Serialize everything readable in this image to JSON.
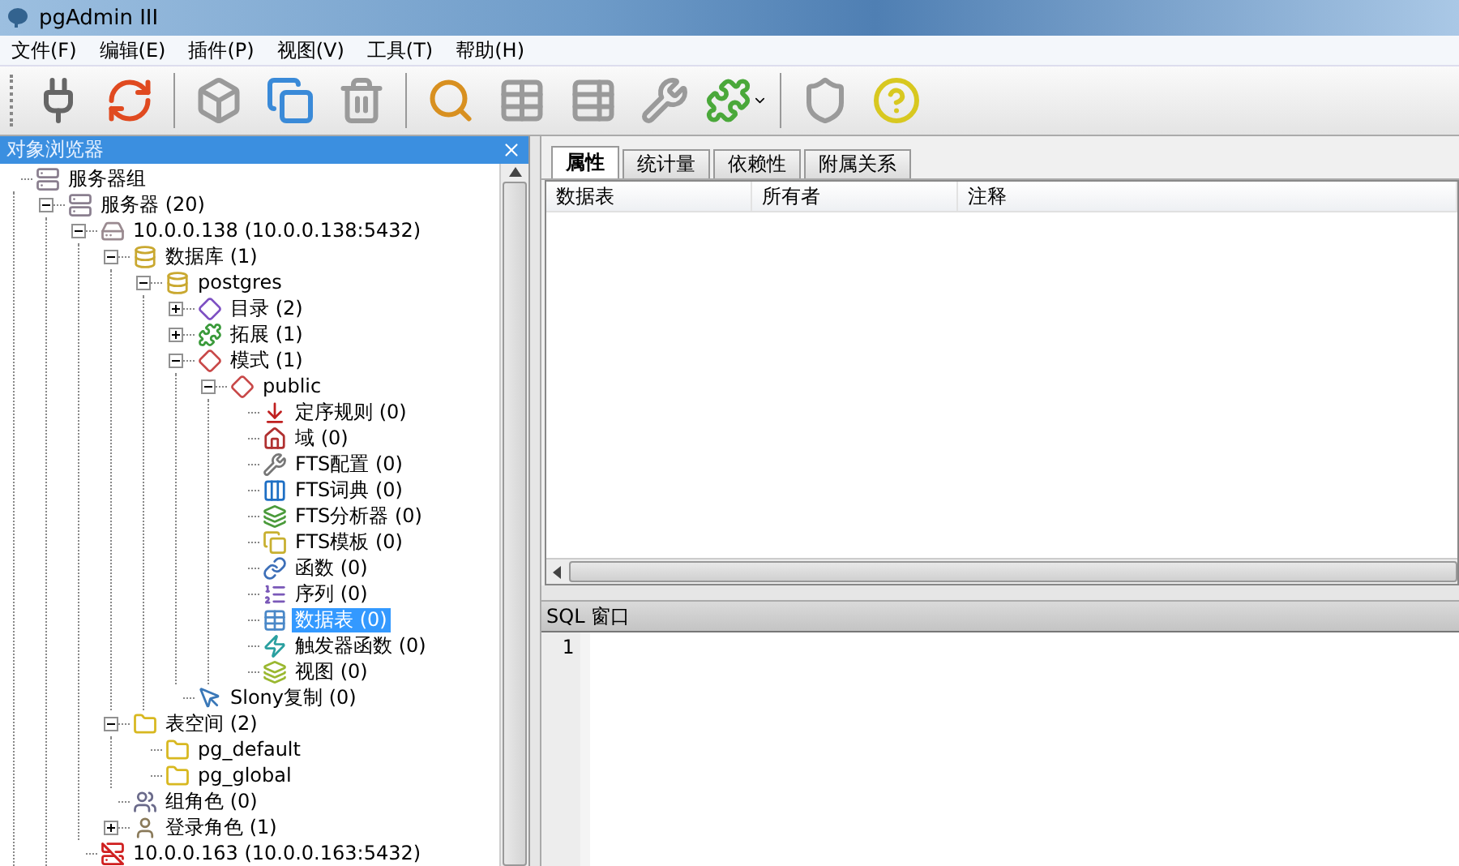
{
  "window": {
    "title": "pgAdmin III"
  },
  "menu": [
    "文件(F)",
    "编辑(E)",
    "插件(P)",
    "视图(V)",
    "工具(T)",
    "帮助(H)"
  ],
  "toolbar": [
    {
      "kind": "plug",
      "disabled": false
    },
    {
      "kind": "refresh",
      "disabled": false
    },
    {
      "kind": "separator"
    },
    {
      "kind": "properties",
      "disabled": true
    },
    {
      "kind": "create",
      "disabled": false
    },
    {
      "kind": "delete",
      "disabled": true
    },
    {
      "kind": "separator"
    },
    {
      "kind": "sql",
      "disabled": false
    },
    {
      "kind": "grid",
      "disabled": true
    },
    {
      "kind": "filter-grid",
      "disabled": true
    },
    {
      "kind": "maintenance",
      "disabled": true
    },
    {
      "kind": "plugins",
      "disabled": false
    },
    {
      "kind": "separator"
    },
    {
      "kind": "hint",
      "disabled": true
    },
    {
      "kind": "help",
      "disabled": false
    }
  ],
  "browser": {
    "title": "对象浏览器",
    "tree": [
      {
        "label": "服务器组",
        "kind": "server-group",
        "selected": false,
        "children": [
          {
            "label": "服务器 (20)",
            "kind": "server-group",
            "selected": false,
            "expanded": true,
            "children": [
              {
                "label": "10.0.0.138 (10.0.0.138:5432)",
                "kind": "server",
                "selected": false,
                "expanded": true,
                "children": [
                  {
                    "label": "数据库 (1)",
                    "kind": "database",
                    "selected": false,
                    "expanded": true,
                    "children": [
                      {
                        "label": "postgres",
                        "kind": "database",
                        "selected": false,
                        "expanded": true,
                        "children": [
                          {
                            "label": "目录 (2)",
                            "kind": "catalog",
                            "selected": false,
                            "expanded": false
                          },
                          {
                            "label": "拓展 (1)",
                            "kind": "extension",
                            "selected": false,
                            "expanded": false
                          },
                          {
                            "label": "模式 (1)",
                            "kind": "schema",
                            "selected": false,
                            "expanded": true,
                            "children": [
                              {
                                "label": "public",
                                "kind": "schema",
                                "selected": false,
                                "expanded": true,
                                "children": [
                                  {
                                    "label": "定序规则 (0)",
                                    "kind": "collation",
                                    "selected": false
                                  },
                                  {
                                    "label": "域 (0)",
                                    "kind": "domain",
                                    "selected": false
                                  },
                                  {
                                    "label": "FTS配置 (0)",
                                    "kind": "fts-config",
                                    "selected": false
                                  },
                                  {
                                    "label": "FTS词典 (0)",
                                    "kind": "fts-dict",
                                    "selected": false
                                  },
                                  {
                                    "label": "FTS分析器 (0)",
                                    "kind": "fts-parser",
                                    "selected": false
                                  },
                                  {
                                    "label": "FTS模板 (0)",
                                    "kind": "fts-template",
                                    "selected": false
                                  },
                                  {
                                    "label": "函数 (0)",
                                    "kind": "function",
                                    "selected": false
                                  },
                                  {
                                    "label": "序列 (0)",
                                    "kind": "sequence",
                                    "selected": false
                                  },
                                  {
                                    "label": "数据表 (0)",
                                    "kind": "table",
                                    "selected": true
                                  },
                                  {
                                    "label": "触发器函数 (0)",
                                    "kind": "trigger-function",
                                    "selected": false
                                  },
                                  {
                                    "label": "视图 (0)",
                                    "kind": "view",
                                    "selected": false
                                  }
                                ]
                              }
                            ]
                          },
                          {
                            "label": "Slony复制 (0)",
                            "kind": "slony",
                            "selected": false
                          }
                        ]
                      }
                    ]
                  },
                  {
                    "label": "表空间 (2)",
                    "kind": "tablespace",
                    "selected": false,
                    "expanded": true,
                    "children": [
                      {
                        "label": "pg_default",
                        "kind": "tablespace",
                        "selected": false
                      },
                      {
                        "label": "pg_global",
                        "kind": "tablespace",
                        "selected": false
                      }
                    ]
                  },
                  {
                    "label": "组角色 (0)",
                    "kind": "group-role",
                    "selected": false
                  },
                  {
                    "label": "登录角色 (1)",
                    "kind": "login-role",
                    "selected": false,
                    "expanded": false
                  }
                ]
              },
              {
                "label": "10.0.0.163 (10.0.0.163:5432)",
                "kind": "server-down",
                "selected": false
              }
            ]
          }
        ]
      }
    ]
  },
  "tabs": [
    {
      "label": "属性",
      "selected": true
    },
    {
      "label": "统计量",
      "selected": false
    },
    {
      "label": "依赖性",
      "selected": false
    },
    {
      "label": "附属关系",
      "selected": false
    }
  ],
  "columns": [
    "数据表",
    "所有者",
    "注释"
  ],
  "sql": {
    "title": "SQL 窗口",
    "line_numbers": [
      "1"
    ]
  }
}
